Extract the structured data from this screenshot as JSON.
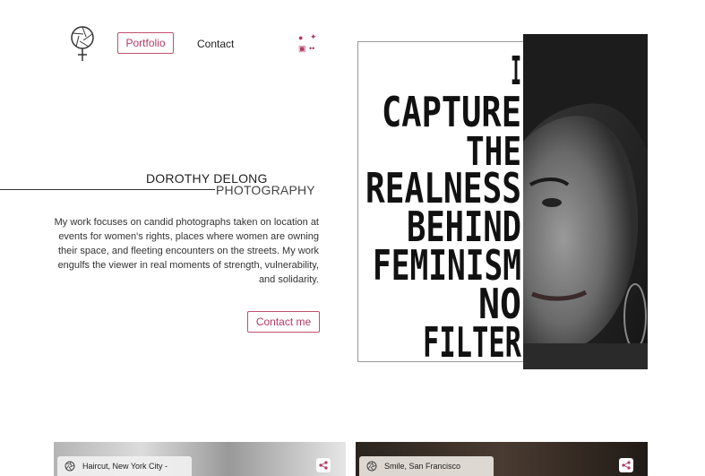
{
  "nav": {
    "portfolio_label": "Portfolio",
    "contact_label": "Contact"
  },
  "brand": {
    "name_line1": "DOROTHY DELONG",
    "name_line2": "PHOTOGRAPHY"
  },
  "bio": "My work focuses on candid photographs taken on location at events for women's rights, places where women are owning their space, and fleeting encounters on the streets. My work engulfs the viewer in real moments of strength, vulnerability, and solidarity.",
  "contact_button_label": "Contact me",
  "hero": {
    "lines": [
      "I",
      "CAPTURE",
      "THE",
      "REALNESS",
      "BEHIND",
      "FEMINISM",
      "NO",
      "FILTER"
    ]
  },
  "cards": [
    {
      "caption": "Haircut, New York City -"
    },
    {
      "caption": "Smile, San Francisco"
    }
  ],
  "icons": {
    "logo": "aperture-venus-icon",
    "social": [
      "facebook-icon",
      "twitter-icon",
      "instagram-icon",
      "flickr-icon"
    ],
    "card": [
      "aperture-icon",
      "share-icon"
    ]
  },
  "colors": {
    "accent": "#b03a60",
    "border": "#c0506e"
  }
}
